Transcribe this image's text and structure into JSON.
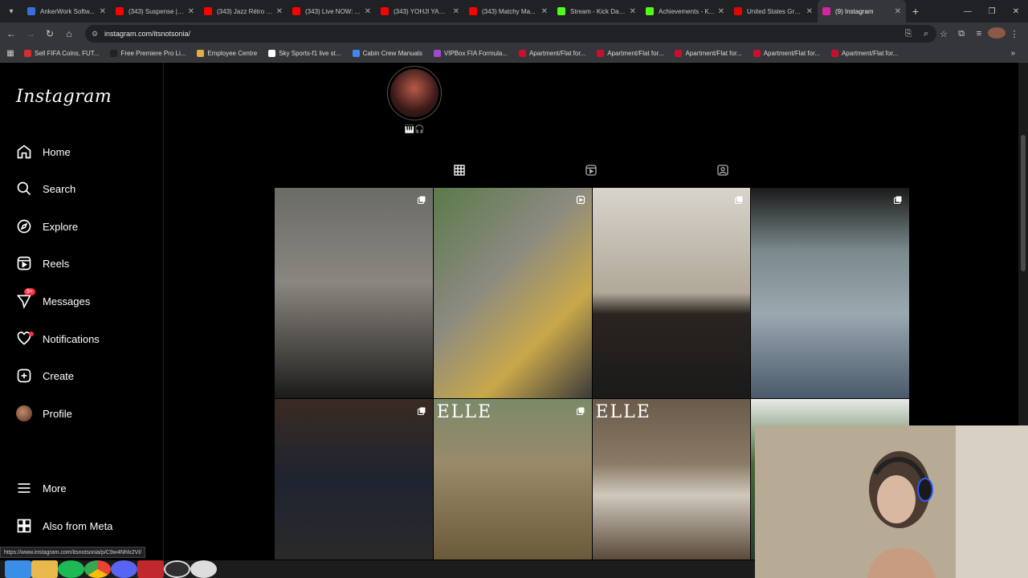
{
  "browser": {
    "tabs": [
      {
        "label": "AnkerWork Softw...",
        "color": "#3b6fd8"
      },
      {
        "label": "(343) Suspense | ...",
        "color": "#ff0000"
      },
      {
        "label": "(343) Jazz Rétro d...",
        "color": "#ff0000"
      },
      {
        "label": "(343) Live NOW: ...",
        "color": "#ff0000"
      },
      {
        "label": "(343) YOHJI YAM...",
        "color": "#ff0000"
      },
      {
        "label": "(343) Matchy Ma...",
        "color": "#ff0000"
      },
      {
        "label": "Stream - Kick Das...",
        "color": "#53fc18"
      },
      {
        "label": "Achievements - K...",
        "color": "#53fc18"
      },
      {
        "label": "United States Gra...",
        "color": "#e10600"
      },
      {
        "label": "(9) Instagram",
        "color": "#d6249f",
        "active": true
      }
    ],
    "url": "instagram.com/itsnotsonia/",
    "bookmarks": [
      {
        "label": "Sell FIFA Coins, FUT...",
        "color": "#d62d2d"
      },
      {
        "label": "Free Premiere Pro Li...",
        "color": "#222222"
      },
      {
        "label": "Employee Centre",
        "color": "#e0b040"
      },
      {
        "label": "Sky Sports-f1 live st...",
        "color": "#ffffff"
      },
      {
        "label": "Cabin Crew Manuals",
        "color": "#4285f4"
      },
      {
        "label": "VIPBox FIA Formula...",
        "color": "#a04ad0"
      },
      {
        "label": "Apartment/Flat for...",
        "color": "#c8102e"
      },
      {
        "label": "Apartment/Flat for...",
        "color": "#c8102e"
      },
      {
        "label": "Apartment/Flat for...",
        "color": "#c8102e"
      },
      {
        "label": "Apartment/Flat for...",
        "color": "#c8102e"
      },
      {
        "label": "Apartment/Flat for...",
        "color": "#c8102e"
      }
    ],
    "status_url": "https://www.instagram.com/itsnotsonia/p/C9w4Nhlx2VI/"
  },
  "sidebar": {
    "logo": "Instagram",
    "items": [
      {
        "label": "Home",
        "icon": "home-icon"
      },
      {
        "label": "Search",
        "icon": "search-icon"
      },
      {
        "label": "Explore",
        "icon": "explore-icon"
      },
      {
        "label": "Reels",
        "icon": "reels-icon"
      },
      {
        "label": "Messages",
        "icon": "messages-icon",
        "badge": "9+"
      },
      {
        "label": "Notifications",
        "icon": "heart-icon",
        "dot": true
      },
      {
        "label": "Create",
        "icon": "create-icon"
      },
      {
        "label": "Profile",
        "icon": "profile-icon"
      },
      {
        "label": "More",
        "icon": "menu-icon"
      },
      {
        "label": "Also from Meta",
        "icon": "meta-icon"
      }
    ]
  },
  "profile": {
    "highlight_label": "🎹🎧"
  },
  "grid": {
    "posts": [
      {
        "bg": "linear-gradient(180deg,#6b6b66 0%,#8a8680 45%,#3c3a36 85%,#1a1a1a 100%)",
        "icon": "carousel"
      },
      {
        "bg": "linear-gradient(135deg,#5a7a4a,#8c8a80 40%,#c8a84a 70%,#3a3a3a)",
        "icon": "reel"
      },
      {
        "bg": "linear-gradient(180deg,#d8d4cc 0%,#b0a898 50%,#2a2420 60%,#1a1a1a 100%)",
        "icon": "carousel"
      },
      {
        "bg": "linear-gradient(180deg,#1a1a1a 0%,#7a8a8c 30%,#9aa8b0 60%,#4a5a6a 100%)",
        "icon": "carousel"
      },
      {
        "bg": "linear-gradient(180deg,#3a2a22 0%,#1e2430 50%,#2a2a2a 100%)",
        "icon": "carousel"
      },
      {
        "bg": "linear-gradient(180deg,#7a8a6a 0%,#9a8a6a 40%,#6a5a3a 100%)",
        "icon": "carousel",
        "caption": "ELLE"
      },
      {
        "bg": "linear-gradient(180deg,#6a5a4a 0%,#8a7a66 40%,#cfc8bc 60%,#5a4a3a 100%)",
        "icon": "none",
        "caption": "ELLE"
      },
      {
        "bg": "linear-gradient(180deg,#e8ece8 0%,#4a6a3a 40%,#2a3a2a 100%)",
        "icon": "none"
      }
    ]
  },
  "colors": {
    "badge": "#ff3040",
    "sidebar_border": "#262626"
  }
}
